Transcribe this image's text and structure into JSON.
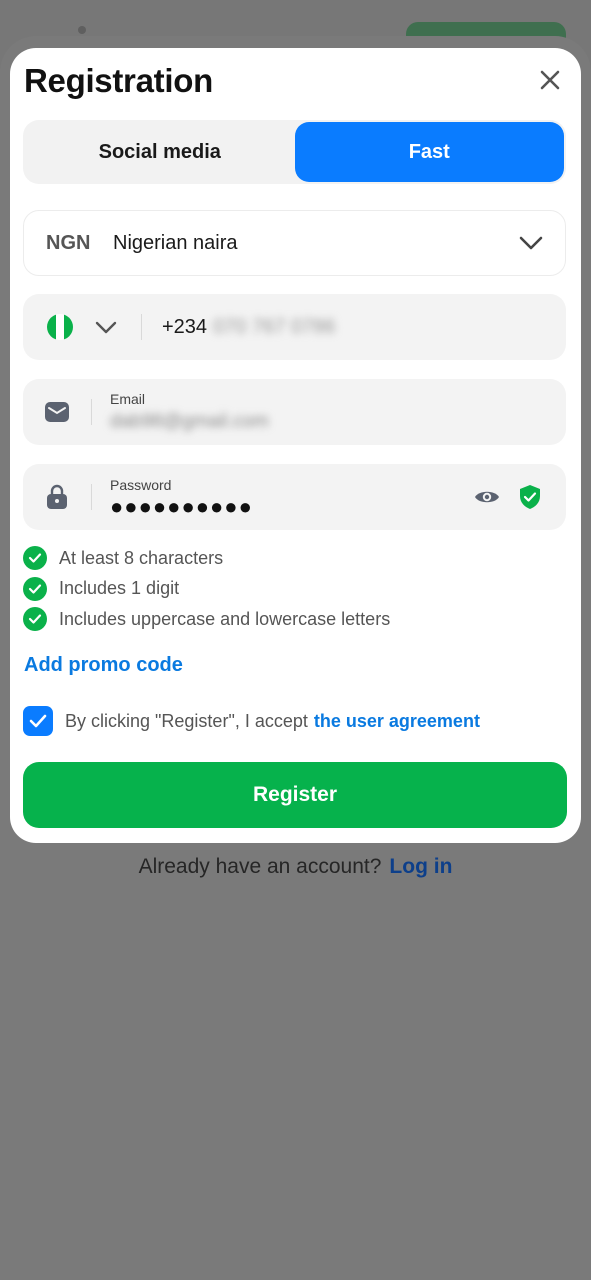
{
  "modal": {
    "title": "Registration",
    "tabs": [
      {
        "label": "Social media",
        "active": false
      },
      {
        "label": "Fast",
        "active": true
      }
    ]
  },
  "currency": {
    "code": "NGN",
    "name": "Nigerian naira"
  },
  "phone": {
    "flag": "nigeria-flag-icon",
    "prefix": "+234",
    "number": "070 767 0786"
  },
  "email": {
    "label": "Email",
    "value": "dab98@gmail.com"
  },
  "password": {
    "label": "Password",
    "masked_value": "●●●●●●●●●●"
  },
  "password_rules": [
    {
      "text": "At least 8 characters",
      "met": true
    },
    {
      "text": "Includes 1 digit",
      "met": true
    },
    {
      "text": "Includes uppercase and lowercase letters",
      "met": true
    }
  ],
  "promo_label": "Add promo code",
  "agreement": {
    "checked": true,
    "text": "By clicking \"Register\", I accept",
    "link": "the user agreement"
  },
  "register_label": "Register",
  "footer": {
    "text": "Already have an account?",
    "link": "Log in"
  },
  "colors": {
    "accent_blue": "#0a7cff",
    "success_green": "#06b24c",
    "link_blue": "#0a7ae0",
    "overlay": "#777777"
  }
}
